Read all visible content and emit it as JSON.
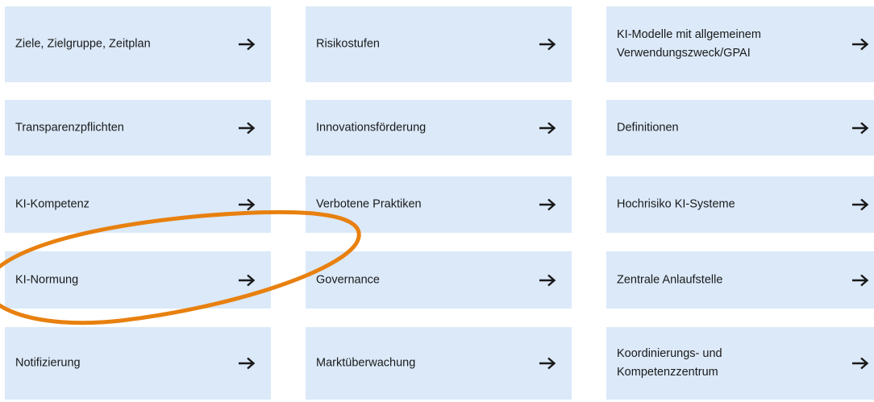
{
  "tiles": [
    {
      "label": "Ziele, Zielgruppe, Zeitplan",
      "icon": "arrow-right-icon"
    },
    {
      "label": "Risikostufen",
      "icon": "arrow-right-icon"
    },
    {
      "label": "KI-Modelle mit allgemeinem\nVerwendungszweck/GPAI",
      "icon": "arrow-right-icon"
    },
    {
      "label": "Transparenzpflichten",
      "icon": "arrow-right-icon"
    },
    {
      "label": "Innovationsförderung",
      "icon": "arrow-right-icon"
    },
    {
      "label": "Definitionen",
      "icon": "arrow-right-icon"
    },
    {
      "label": "KI-Kompetenz",
      "icon": "arrow-right-icon"
    },
    {
      "label": "Verbotene Praktiken",
      "icon": "arrow-right-icon"
    },
    {
      "label": "Hochrisiko KI-Systeme",
      "icon": "arrow-right-icon"
    },
    {
      "label": "KI-Normung",
      "icon": "arrow-right-icon"
    },
    {
      "label": "Governance",
      "icon": "arrow-right-icon"
    },
    {
      "label": "Zentrale Anlaufstelle",
      "icon": "arrow-right-icon"
    },
    {
      "label": "Notifizierung",
      "icon": "arrow-right-icon"
    },
    {
      "label": "Marktüberwachung",
      "icon": "arrow-right-icon"
    },
    {
      "label": "Koordinierungs- und\nKompetenzzentrum",
      "icon": "arrow-right-icon"
    }
  ],
  "colors": {
    "tile_background": "#dbe9f9",
    "text": "#1a1a1a",
    "highlight_ellipse": "#e8800f"
  },
  "highlight": {
    "icon": "highlight-ellipse",
    "target_label": "KI-Normung"
  }
}
